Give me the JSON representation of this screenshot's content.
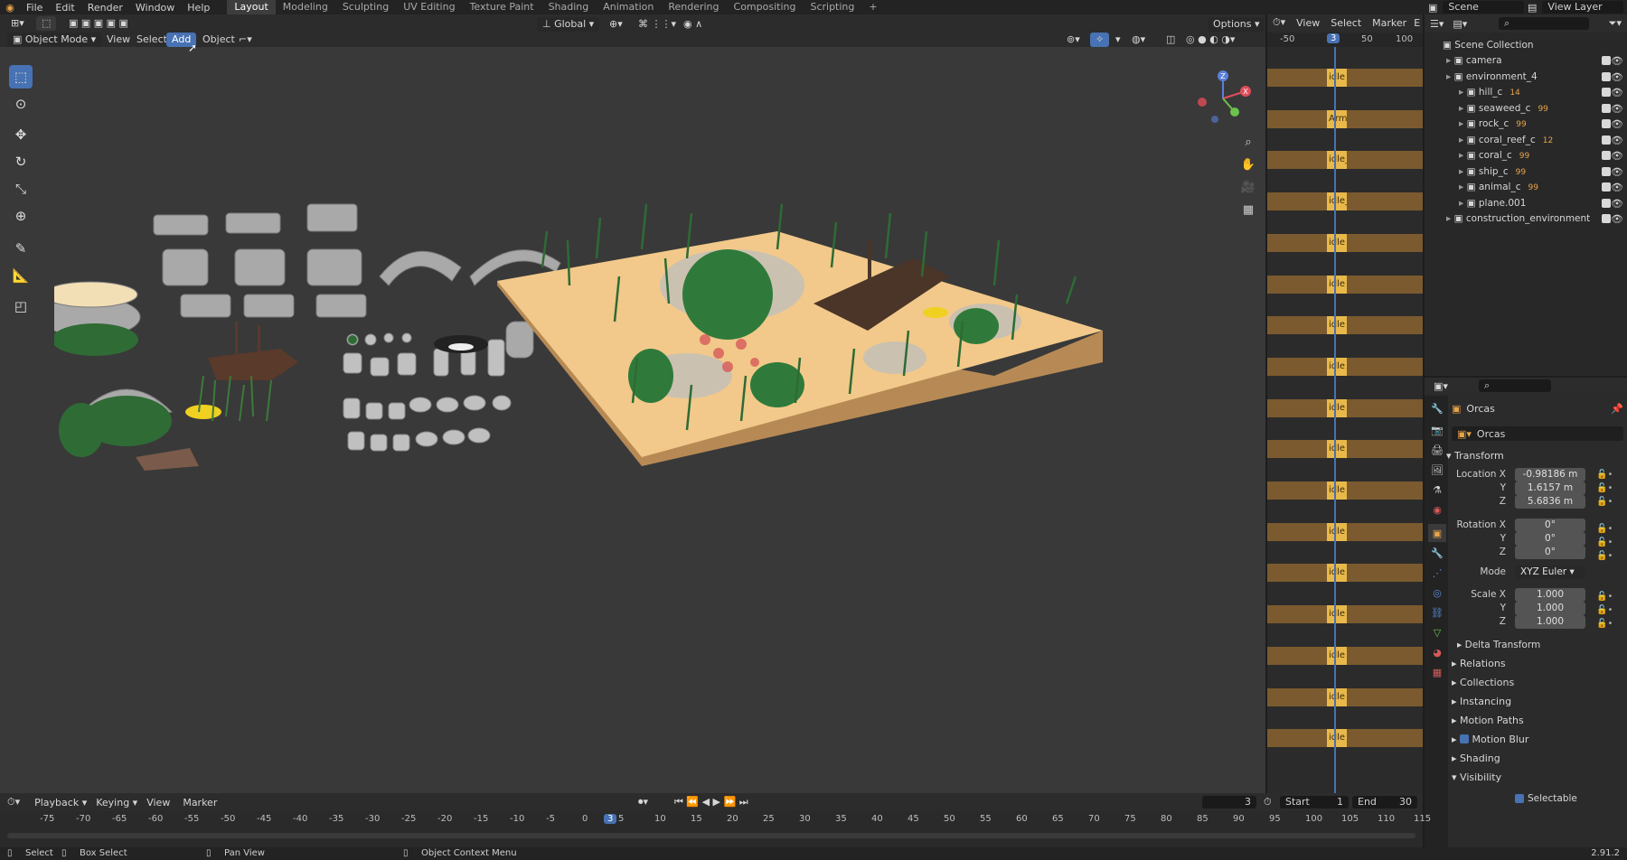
{
  "topbar": {
    "menus": [
      "File",
      "Edit",
      "Render",
      "Window",
      "Help"
    ],
    "workspaces": [
      "Layout",
      "Modeling",
      "Sculpting",
      "UV Editing",
      "Texture Paint",
      "Shading",
      "Animation",
      "Rendering",
      "Compositing",
      "Scripting"
    ],
    "active_workspace": "Layout",
    "add_tab": "+",
    "scene": "Scene",
    "view_layer": "View Layer"
  },
  "viewport": {
    "mode": "Object Mode",
    "menus": {
      "view": "View",
      "select": "Select",
      "add": "Add",
      "object": "Object"
    },
    "transform_orientation": "Global",
    "options": "Options",
    "gizmo_axes": {
      "x": "X",
      "y": "Y",
      "z": "Z"
    }
  },
  "dopesheet": {
    "menus": {
      "view": "View",
      "select": "Select",
      "marker": "Marker",
      "extra": "E"
    },
    "ruler": [
      "-50",
      "50",
      "100"
    ],
    "current_frame": "3",
    "rows": [
      "idle",
      "Armat",
      "idle_M",
      "idle_O",
      "idle",
      "idle",
      "idle",
      "idle",
      "idle",
      "idle",
      "idle",
      "idle",
      "idle",
      "idle",
      "idle",
      "idle",
      "idle"
    ]
  },
  "outliner": {
    "root": "Scene Collection",
    "items": [
      {
        "label": "camera",
        "indent": 1
      },
      {
        "label": "environment_4",
        "indent": 1
      },
      {
        "label": "hill_c",
        "indent": 2,
        "count": "14"
      },
      {
        "label": "seaweed_c",
        "indent": 2,
        "count": "99"
      },
      {
        "label": "rock_c",
        "indent": 2,
        "count": "99"
      },
      {
        "label": "coral_reef_c",
        "indent": 2,
        "count": "12"
      },
      {
        "label": "coral_c",
        "indent": 2,
        "count": "99"
      },
      {
        "label": "ship_c",
        "indent": 2,
        "count": "99"
      },
      {
        "label": "animal_c",
        "indent": 2,
        "count": "99"
      },
      {
        "label": "plane.001",
        "indent": 2
      },
      {
        "label": "construction_environment",
        "indent": 1
      }
    ]
  },
  "properties": {
    "object_name": "Orcas",
    "datablock_name": "Orcas",
    "transform_title": "Transform",
    "location": {
      "label": "Location X",
      "x": "-0.98186 m",
      "y": "1.6157 m",
      "z": "5.6836 m"
    },
    "rotation": {
      "label": "Rotation X",
      "x": "0°",
      "y": "0°",
      "z": "0°"
    },
    "mode_label": "Mode",
    "mode_value": "XYZ Euler",
    "scale": {
      "label": "Scale X",
      "x": "1.000",
      "y": "1.000",
      "z": "1.000"
    },
    "axis_y": "Y",
    "axis_z": "Z",
    "sections": [
      "Delta Transform",
      "Relations",
      "Collections",
      "Instancing",
      "Motion Paths",
      "Motion Blur",
      "Shading",
      "Visibility"
    ],
    "selectable": "Selectable"
  },
  "timeline": {
    "menus": {
      "playback": "Playback",
      "keying": "Keying",
      "view": "View",
      "marker": "Marker"
    },
    "frame": "3",
    "start_label": "Start",
    "start": "1",
    "end_label": "End",
    "end": "30",
    "ruler": [
      "-75",
      "-70",
      "-65",
      "-60",
      "-55",
      "-50",
      "-45",
      "-40",
      "-35",
      "-30",
      "-25",
      "-20",
      "-15",
      "-10",
      "-5",
      "0",
      "3",
      "5",
      "10",
      "15",
      "20",
      "25",
      "30",
      "35",
      "40",
      "45",
      "50",
      "55",
      "60",
      "65",
      "70",
      "75",
      "80",
      "85",
      "90",
      "95",
      "100",
      "105",
      "110",
      "115"
    ]
  },
  "statusbar": {
    "select": "Select",
    "box_select": "Box Select",
    "pan_view": "Pan View",
    "context_menu": "Object Context Menu",
    "version": "2.91.2"
  },
  "colors": {
    "accent": "#4772b3",
    "sand": "#f2c98a",
    "seaweed": "#2f6b35",
    "keyframe": "#e8b84a",
    "keyrow": "#7a5a2e"
  }
}
